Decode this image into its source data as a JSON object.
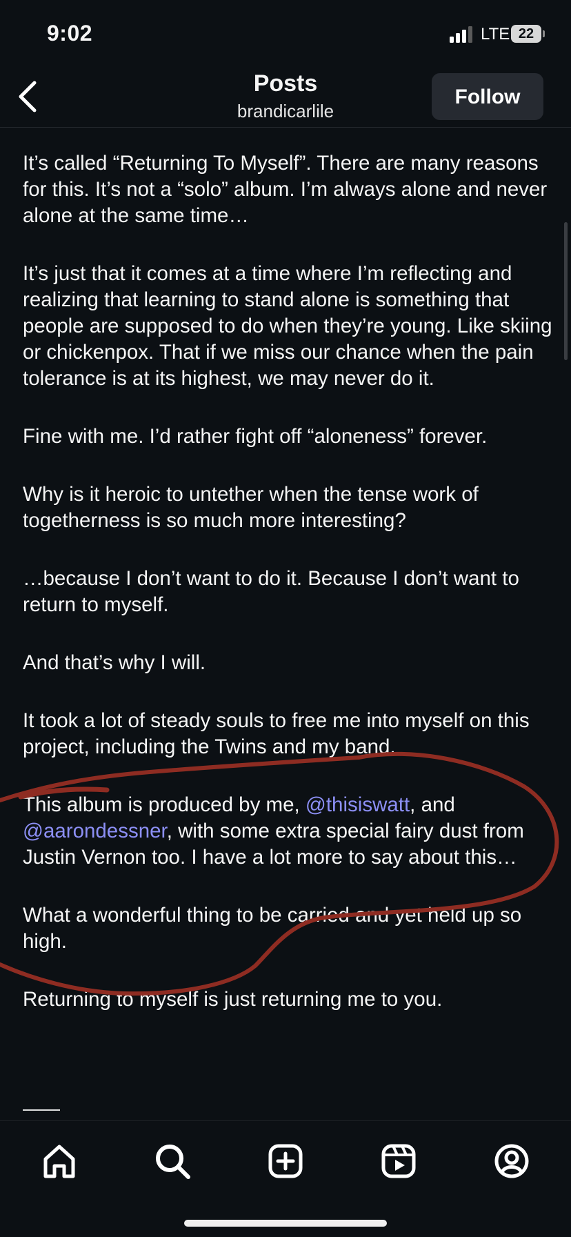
{
  "status_bar": {
    "time": "9:02",
    "network": "LTE",
    "battery": "22"
  },
  "header": {
    "title": "Posts",
    "username": "brandicarlile",
    "follow_label": "Follow"
  },
  "post": {
    "paragraphs": [
      "It’s called “Returning To Myself”. There are many reasons for this. It’s not a “solo” album. I’m always alone and never alone at the same time…",
      "It’s just that it comes at a time where I’m reflecting and realizing that learning to stand alone is something that people are supposed to do when they’re young. Like skiing or chickenpox. That if we miss our chance when the pain tolerance is at its highest, we may never do it.",
      "Fine with me. I’d rather fight off “aloneness” forever.",
      "Why is it heroic to untether when the tense work of togetherness is so much more interesting?",
      "…because I don’t want to do it. Because I don’t want to return to myself.",
      "And that’s why I will.",
      "It took a lot of steady souls to free me into myself on this project, including the Twins and my band."
    ],
    "credits": {
      "part1": "This album is produced by me, ",
      "mention1": "@thisiswatt",
      "part2": ", and ",
      "mention2": "@aarondessner",
      "part3": ", with some extra special fairy dust from Justin Vernon too. I have a lot more to say about this…"
    },
    "paragraphs_after": [
      "What a wonderful thing to be carried and yet held up so high.",
      "Returning to myself is just returning me to you."
    ],
    "divider": "——"
  },
  "tabbar": {
    "tabs": [
      {
        "icon": "home-icon"
      },
      {
        "icon": "search-icon"
      },
      {
        "icon": "create-icon"
      },
      {
        "icon": "reels-icon"
      },
      {
        "icon": "profile-icon"
      }
    ]
  },
  "colors": {
    "background": "#0c1014",
    "mention": "#8c8ff5",
    "annotation": "#8e2c22",
    "follow_button": "#262a31"
  }
}
